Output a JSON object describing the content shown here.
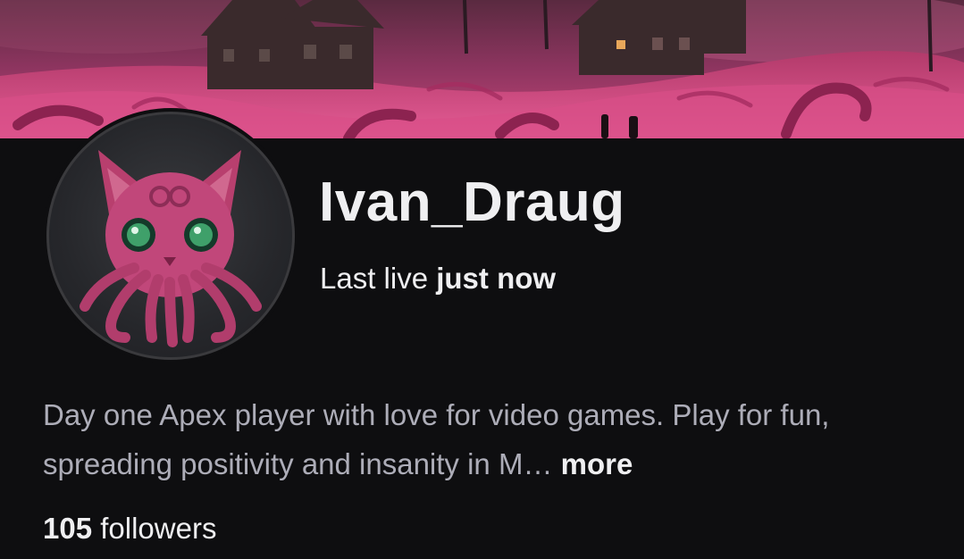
{
  "channel": {
    "name": "Ivan_Draug",
    "last_live_label": "Last live",
    "last_live_value": "just now",
    "bio_text": "Day one Apex player with love for video games. Play for fun, spreading positivity and insanity in M…",
    "more_label": "more",
    "followers_count": "105",
    "followers_label": "followers"
  },
  "colors": {
    "background": "#0e0e10",
    "text_primary": "#efeff1",
    "text_secondary": "#adadb8",
    "banner_accent": "#c23d74"
  },
  "icons": {
    "banner": "horror-village-banner-image",
    "avatar": "pink-cthulhu-cat-avatar"
  }
}
